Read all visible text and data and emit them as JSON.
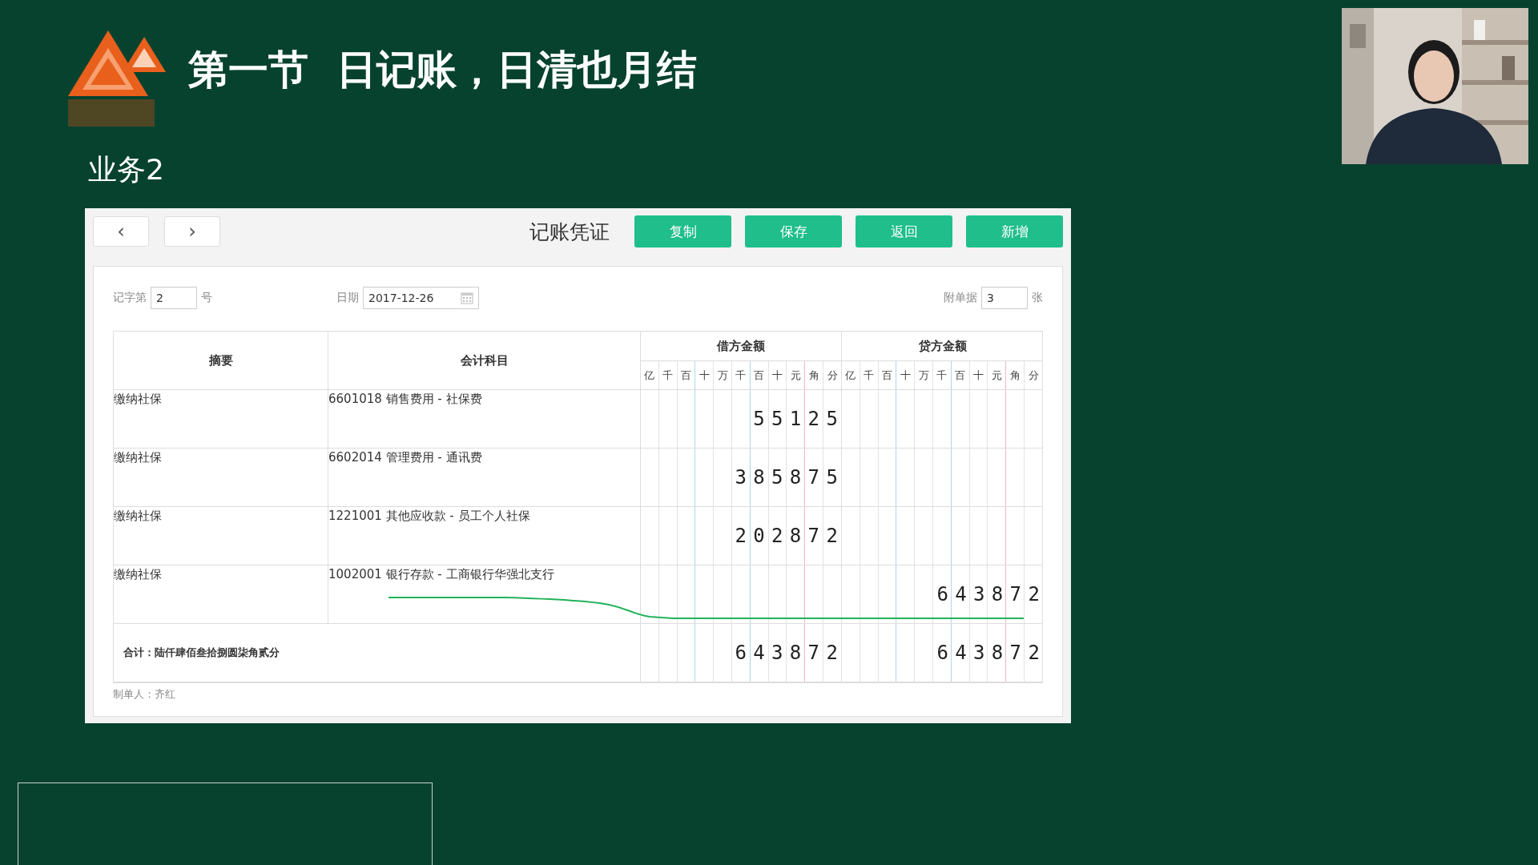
{
  "slide": {
    "title": "第一节  日记账，日清也月结",
    "subtitle": "业务2"
  },
  "app": {
    "nav": [
      "‹",
      "›"
    ],
    "title": "记账凭证",
    "buttons": [
      "复制",
      "保存",
      "返回",
      "新增"
    ],
    "form": {
      "number_label": "记字第",
      "number": "2",
      "number_suffix": "号",
      "date_label": "日期",
      "date": "2017-12-26",
      "attach_label": "附单据",
      "attach": "3",
      "attach_suffix": "张"
    },
    "table": {
      "columns": [
        "摘要",
        "会计科目"
      ],
      "debit": {
        "title": "借方金额",
        "units": [
          "亿",
          "千",
          "百",
          "十",
          "万",
          "千",
          "百",
          "十",
          "元",
          "角",
          "分"
        ]
      },
      "credit": {
        "title": "贷方金额",
        "units": [
          "亿",
          "千",
          "百",
          "十",
          "万",
          "千",
          "百",
          "十",
          "元",
          "角",
          "分"
        ]
      },
      "rows": [
        {
          "summary": "缴纳社保",
          "account": "6601018 销售费用 - 社保费",
          "debit": "55125"
        },
        {
          "summary": "缴纳社保",
          "account": "6602014 管理费用 - 通讯费",
          "debit": "385875"
        },
        {
          "summary": "缴纳社保",
          "account": "1221001 其他应收款 - 员工个人社保",
          "debit": "202872"
        },
        {
          "summary": "缴纳社保",
          "account": "1002001 银行存款 - 工商银行华强北支行",
          "credit": "643872"
        }
      ],
      "total": {
        "label": "合计：陆仟肆佰叁拾捌圆柒角贰分",
        "debit": "643872",
        "credit": "643872"
      }
    },
    "maker": "制单人：齐红"
  }
}
